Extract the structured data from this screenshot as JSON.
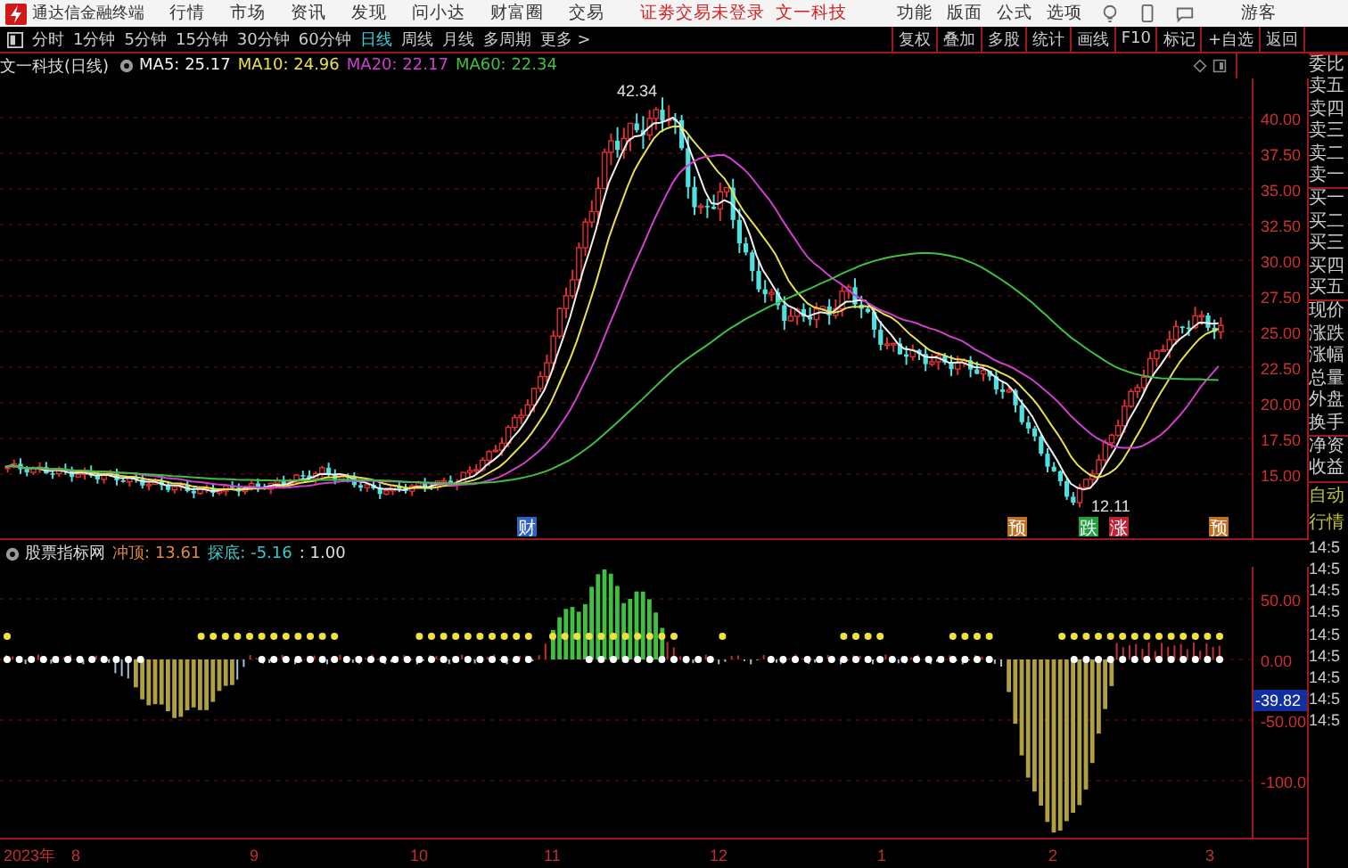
{
  "app_bar": {
    "title": "通达信金融终端",
    "menus": [
      "行情",
      "市场",
      "资讯",
      "发现",
      "问小达",
      "财富圈",
      "交易"
    ],
    "login_status": "证劵交易未登录",
    "stock_name": "文一科技",
    "right_menus": [
      "功能",
      "版面",
      "公式",
      "选项"
    ],
    "user": "游客"
  },
  "period_tabs": [
    {
      "label": "分时",
      "selected": false
    },
    {
      "label": "1分钟",
      "selected": false
    },
    {
      "label": "5分钟",
      "selected": false
    },
    {
      "label": "15分钟",
      "selected": false
    },
    {
      "label": "30分钟",
      "selected": false
    },
    {
      "label": "60分钟",
      "selected": false
    },
    {
      "label": "日线",
      "selected": true
    },
    {
      "label": "周线",
      "selected": false
    },
    {
      "label": "月线",
      "selected": false
    },
    {
      "label": "多周期",
      "selected": false
    },
    {
      "label": "更多 >",
      "selected": false
    }
  ],
  "tool_buttons": [
    "复权",
    "叠加",
    "多股",
    "统计",
    "画线",
    "F10",
    "标记",
    "+自选",
    "返回"
  ],
  "legend": {
    "title": "文一科技(日线)",
    "items": [
      {
        "label": "MA5: 25.17",
        "color": "#f0f0f0"
      },
      {
        "label": "MA10: 24.96",
        "color": "#e8e050"
      },
      {
        "label": "MA20: 22.17",
        "color": "#d040d0"
      },
      {
        "label": "MA60: 22.34",
        "color": "#40c040"
      }
    ]
  },
  "price_axis": [
    "40.00",
    "37.50",
    "35.00",
    "32.50",
    "30.00",
    "27.50",
    "25.00",
    "22.50",
    "20.00",
    "17.50",
    "15.00"
  ],
  "chart_notes": {
    "high": "42.34",
    "low": "12.11"
  },
  "event_markers": [
    {
      "label": "财",
      "color": "#3060c0"
    },
    {
      "label": "预",
      "color": "#c07020"
    },
    {
      "label": "跌",
      "color": "#20a040"
    },
    {
      "label": "涨",
      "color": "#c02030"
    },
    {
      "label": "预",
      "color": "#c07020"
    }
  ],
  "indicator": {
    "name": "股票指标网",
    "values": [
      {
        "label": "冲顶: 13.61",
        "color": "#e08a3a"
      },
      {
        "label": "探底: -5.16",
        "color": "#40c8c8"
      },
      {
        "label": ": 1.00",
        "color": "#e0e0e0"
      }
    ],
    "axis": [
      "50.00",
      "0.00",
      "-50.00",
      "-100.0"
    ],
    "current": "-39.82"
  },
  "date_axis": [
    "2023年",
    "8",
    "9",
    "10",
    "11",
    "12",
    "1",
    "2",
    "3"
  ],
  "quote_panel": {
    "labels": [
      "委比",
      "卖五",
      "卖四",
      "卖三",
      "卖二",
      "卖一",
      "买一",
      "买二",
      "买三",
      "买四",
      "买五",
      "现价",
      "涨跌",
      "涨幅",
      "总量",
      "外盘",
      "换手",
      "净资",
      "收益"
    ],
    "mode_buttons": [
      "自动",
      "行情"
    ],
    "times": [
      "14:5",
      "14:5",
      "14:5",
      "14:5",
      "14:5",
      "14:5",
      "14:5",
      "14:5",
      "14:5"
    ]
  }
}
